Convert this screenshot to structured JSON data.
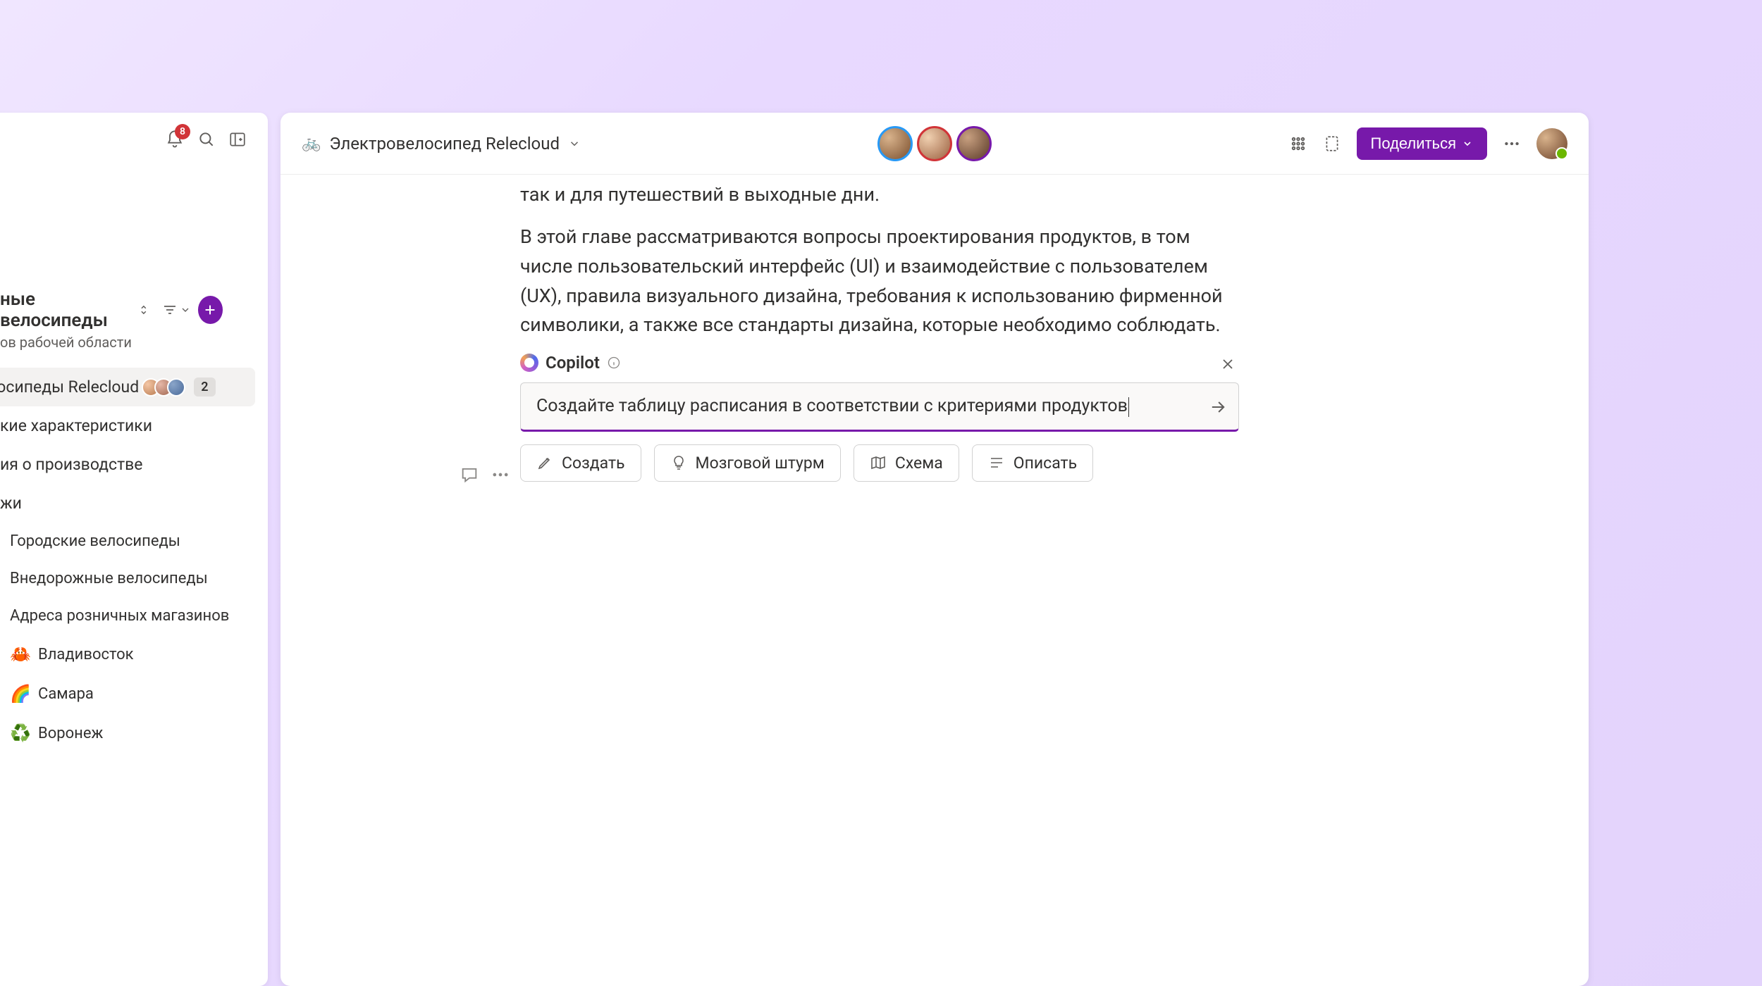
{
  "leftBar": {
    "notificationCount": "8"
  },
  "workspace": {
    "title": "ные велосипеды",
    "subtitle": "ов рабочей области"
  },
  "nav": {
    "items": [
      {
        "label": "лосипеды Relecloud",
        "count": "2"
      },
      {
        "label": "кие характеристики"
      },
      {
        "label": "ия о производстве"
      },
      {
        "label": "жи"
      },
      {
        "label": "Городские велосипеды"
      },
      {
        "label": "Внедорожные велосипеды"
      },
      {
        "label": "Адреса розничных магазинов"
      },
      {
        "label": "Владивосток",
        "emoji": "🦀"
      },
      {
        "label": "Самара",
        "emoji": "🌈"
      },
      {
        "label": "Воронеж",
        "emoji": "♻️"
      }
    ]
  },
  "header": {
    "docTitle": "Электровелосипед Relecloud",
    "shareLabel": "Поделиться"
  },
  "document": {
    "p1": "так и для путешествий в выходные дни.",
    "p2": "В этой главе рассматриваются вопросы проектирования продуктов, в том числе пользовательский интерфейс (UI) и взаимодействие с пользователем (UX), правила визуального дизайна, требования к использованию фирменной символики, а также все стандарты дизайна, которые необходимо соблюдать."
  },
  "copilot": {
    "title": "Copilot",
    "inputValue": "Создайте таблицу расписания в соответствии с критериями продуктов",
    "chips": {
      "create": "Создать",
      "brainstorm": "Мозговой штурм",
      "schema": "Схема",
      "describe": "Описать"
    }
  }
}
